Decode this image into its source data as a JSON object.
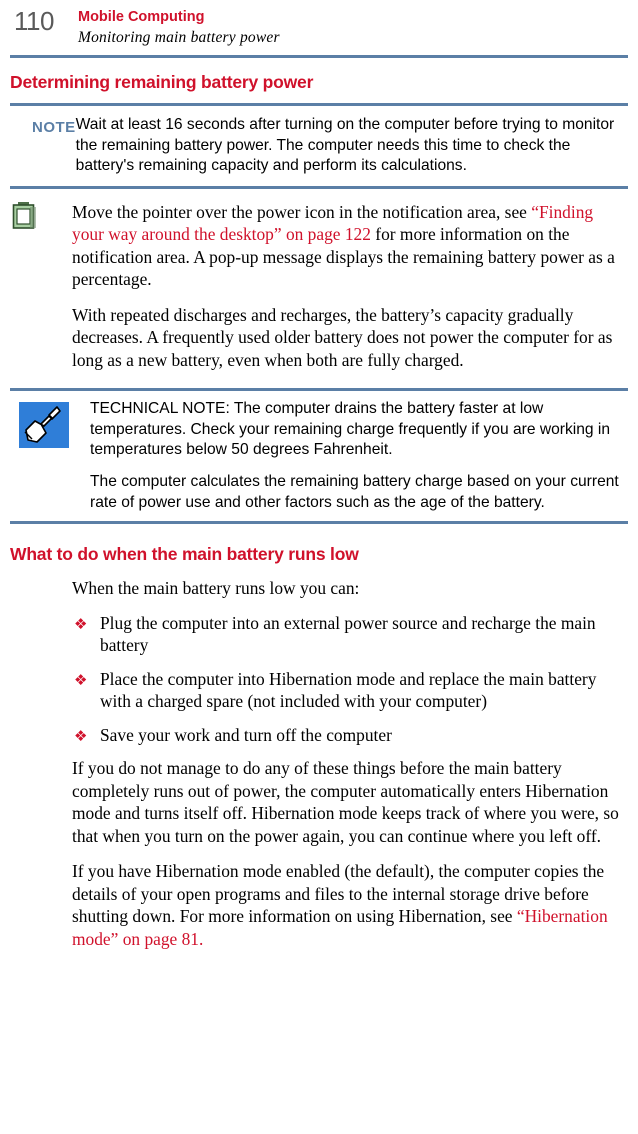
{
  "header": {
    "page_number": "110",
    "title": "Mobile Computing",
    "subtitle": "Monitoring main battery power"
  },
  "sections": {
    "first_heading": "Determining remaining battery power",
    "second_heading": "What to do when the main battery runs low"
  },
  "note_block": {
    "label": "NOTE",
    "text": "Wait at least 16 seconds after turning on the computer before trying to monitor the remaining battery power. The computer needs this time to check the battery's remaining capacity and perform its calculations."
  },
  "battery_block": {
    "icon": "battery-icon",
    "paragraph_1_part_1": "Move the pointer over the power icon in the notification area, see ",
    "paragraph_1_link": "“Finding your way around the desktop” on page 122",
    "paragraph_1_part_2": " for more information on the notification area. A pop-up message displays the remaining battery power as a percentage.",
    "paragraph_2": "With repeated discharges and recharges, the battery’s capacity gradually decreases. A frequently used older battery does not power the computer for as long as a new battery, even when both are fully charged."
  },
  "technical_note": {
    "icon": "wrench-icon",
    "paragraph_1": "TECHNICAL NOTE: The computer drains the battery faster at low temperatures. Check your remaining charge frequently if you are working in temperatures below 50 degrees Fahrenheit.",
    "paragraph_2": "The computer calculates the remaining battery charge based on your current rate of power use and other factors such as the age of the battery."
  },
  "low_battery": {
    "intro": "When the main battery runs low you can:",
    "bullets": [
      "Plug the computer into an external power source and recharge the main battery",
      "Place the computer into Hibernation mode and replace the main battery with a charged spare (not included with your computer)",
      "Save your work and turn off the computer"
    ],
    "paragraph_1": "If you do not manage to do any of these things before the main battery completely runs out of power, the computer automatically enters Hibernation mode and turns itself off. Hibernation mode keeps track of where you were, so that when you turn on the power again, you can continue where you left off.",
    "paragraph_2_part_1": "If you have Hibernation mode enabled (the default), the computer copies the details of your open programs and files to the internal storage drive before shutting down. For more information on using Hibernation, see ",
    "paragraph_2_link": "“Hibernation mode” on page 81.",
    "bullet_glyph": "❖"
  },
  "colors": {
    "accent_red": "#d0112b",
    "rule_blue": "#5b7fa6",
    "page_number_gray": "#5a5a5a"
  }
}
